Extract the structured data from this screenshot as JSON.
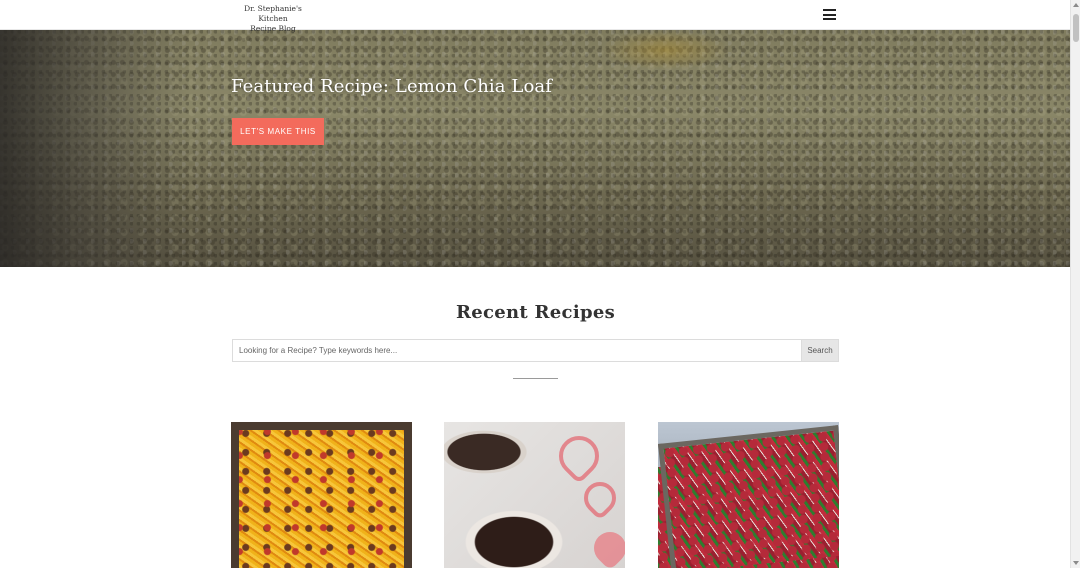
{
  "header": {
    "logo_line1": "Dr. Stephanie's Kitchen",
    "logo_line2": "Recipe Blog",
    "menu_icon": "hamburger-menu-icon"
  },
  "hero": {
    "title": "Featured Recipe: Lemon Chia Loaf",
    "button_label": "LET'S MAKE THIS",
    "button_color": "#f36b5c"
  },
  "recent": {
    "title": "Recent Recipes",
    "search_placeholder": "Looking for a Recipe? Type keywords here...",
    "search_button": "Search"
  },
  "cards": [
    {
      "image": "taco-casserole-photo"
    },
    {
      "image": "chocolate-lava-cake-photo"
    },
    {
      "image": "steak-fajitas-photo"
    }
  ]
}
